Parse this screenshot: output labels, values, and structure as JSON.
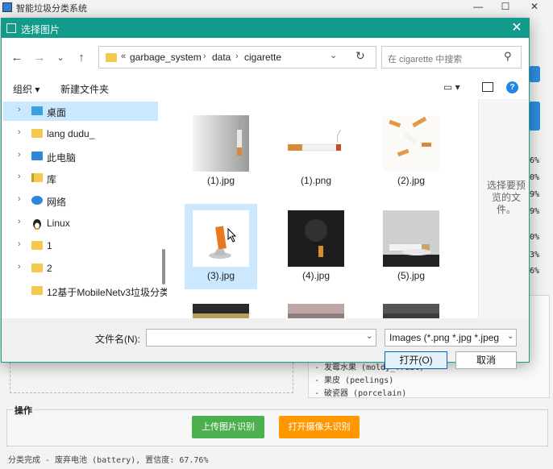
{
  "app": {
    "title": "智能垃圾分类系统",
    "minimize": "—",
    "maximize": "☐",
    "close": "✕"
  },
  "class_list": [
    "- 发霉水果 (moldy_fruit)",
    "- 果皮 (peelings)",
    "- 破瓷器 (porcelain)"
  ],
  "confidence_peek": [
    "6%",
    "0%",
    "9%",
    "9%",
    "0%",
    "3%",
    "6%"
  ],
  "operations": {
    "group_label": "操作",
    "upload_button": "上传图片识别",
    "camera_button": "打开摄像头识别"
  },
  "status": {
    "text": "分类完成 - 废弃电池 (battery), 置信度: 67.76%"
  },
  "dialog": {
    "title": "选择图片",
    "close": "✕",
    "nav": {
      "back": "←",
      "forward": "→",
      "recent": "⌄",
      "up": "↑"
    },
    "breadcrumb": {
      "overflow": "«",
      "parts": [
        "garbage_system",
        "data",
        "cigarette"
      ],
      "separator": "›",
      "dropdown": "⌄",
      "refresh": "↻"
    },
    "search": {
      "placeholder": "在 cigarette 中搜索",
      "icon": "⚲"
    },
    "toolbar": {
      "organize": "组织 ▾",
      "new_folder": "新建文件夹",
      "view": "▭ ▾",
      "help": "?"
    },
    "tree": [
      {
        "label": "桌面",
        "icon": "desktop-icon",
        "selected": true
      },
      {
        "label": "lang dudu_",
        "icon": "folder-icon"
      },
      {
        "label": "此电脑",
        "icon": "pc-icon"
      },
      {
        "label": "库",
        "icon": "library-icon"
      },
      {
        "label": "网络",
        "icon": "network-icon"
      },
      {
        "label": "Linux",
        "icon": "linux-icon"
      },
      {
        "label": "1",
        "icon": "folder-icon"
      },
      {
        "label": "2",
        "icon": "folder-icon"
      },
      {
        "label": "12基于MobileNetv3垃圾分类",
        "icon": "folder-icon"
      }
    ],
    "files": [
      {
        "name": "(1).jpg"
      },
      {
        "name": "(1).png"
      },
      {
        "name": "(2).jpg"
      },
      {
        "name": "(3).jpg",
        "selected": true
      },
      {
        "name": "(4).jpg"
      },
      {
        "name": "(5).jpg"
      },
      {
        "name": ""
      },
      {
        "name": ""
      },
      {
        "name": ""
      }
    ],
    "preview_text": "选择要预览的文件。",
    "filename_label": "文件名(N):",
    "filename_value": "",
    "filter": "Images (*.png *.jpg *.jpeg",
    "dropdown_arrow": "⌄",
    "open_button": "打开(O)",
    "cancel_button": "取消"
  },
  "colors": {
    "dialog_title_bg": "#129b8b",
    "upload_button": "#4caf50",
    "camera_button": "#ff9800",
    "selection": "#cce8ff"
  }
}
